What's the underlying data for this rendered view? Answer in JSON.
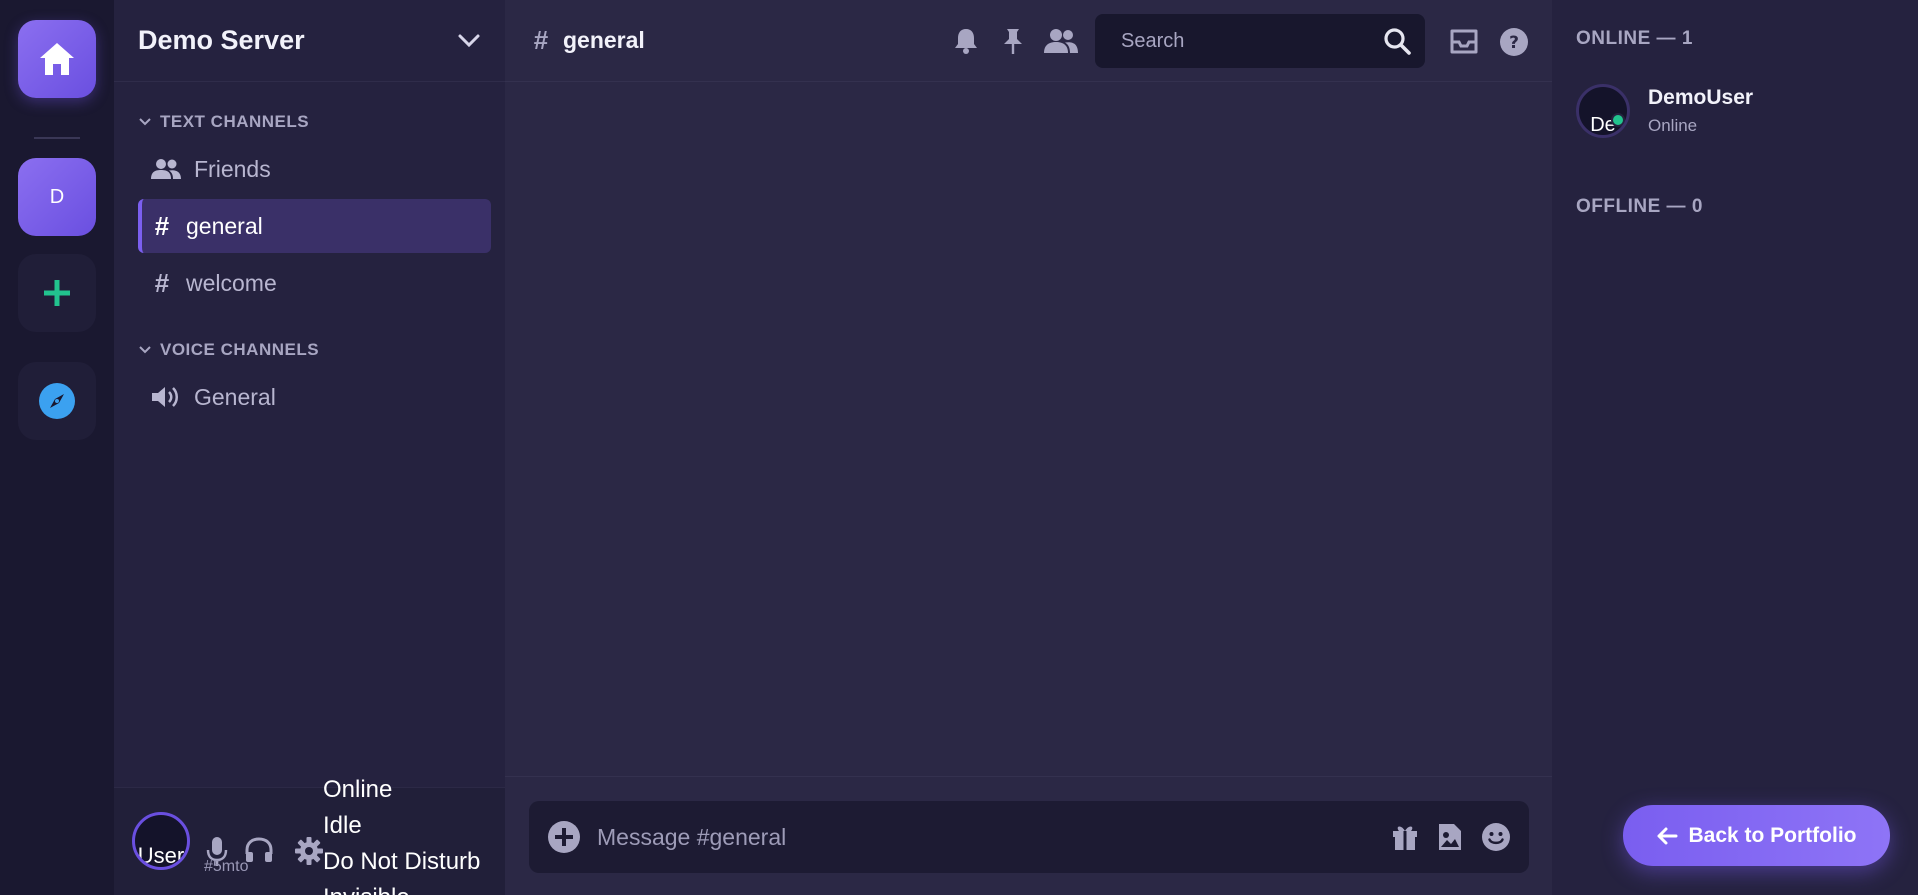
{
  "rail": {
    "server_initial": "D"
  },
  "sidebar": {
    "server_name": "Demo Server",
    "text_category": "TEXT CHANNELS",
    "voice_category": "VOICE CHANNELS",
    "items": [
      {
        "label": "Friends",
        "icon": "friends-icon"
      },
      {
        "label": "general",
        "icon": "hash-icon",
        "active": true
      },
      {
        "label": "welcome",
        "icon": "hash-icon"
      }
    ],
    "voice_items": [
      {
        "label": "General",
        "icon": "speaker-icon"
      }
    ]
  },
  "user_panel": {
    "avatar_text": "User",
    "tag": "#5mto",
    "status_options": [
      "Online",
      "Idle",
      "Do Not Disturb",
      "Invisible"
    ]
  },
  "header": {
    "channel": "general",
    "search_placeholder": "Search"
  },
  "composer": {
    "placeholder": "Message #general"
  },
  "members": {
    "online_header": "ONLINE — 1",
    "offline_header": "OFFLINE — 0",
    "list": [
      {
        "avatar_text": "De",
        "name": "DemoUser",
        "status": "Online"
      }
    ]
  },
  "portfolio": {
    "label": "Back to Portfolio"
  },
  "colors": {
    "accent": "#7b5ff0",
    "online": "#22c38e",
    "add": "#22c38e",
    "explore": "#3ba1f0"
  }
}
